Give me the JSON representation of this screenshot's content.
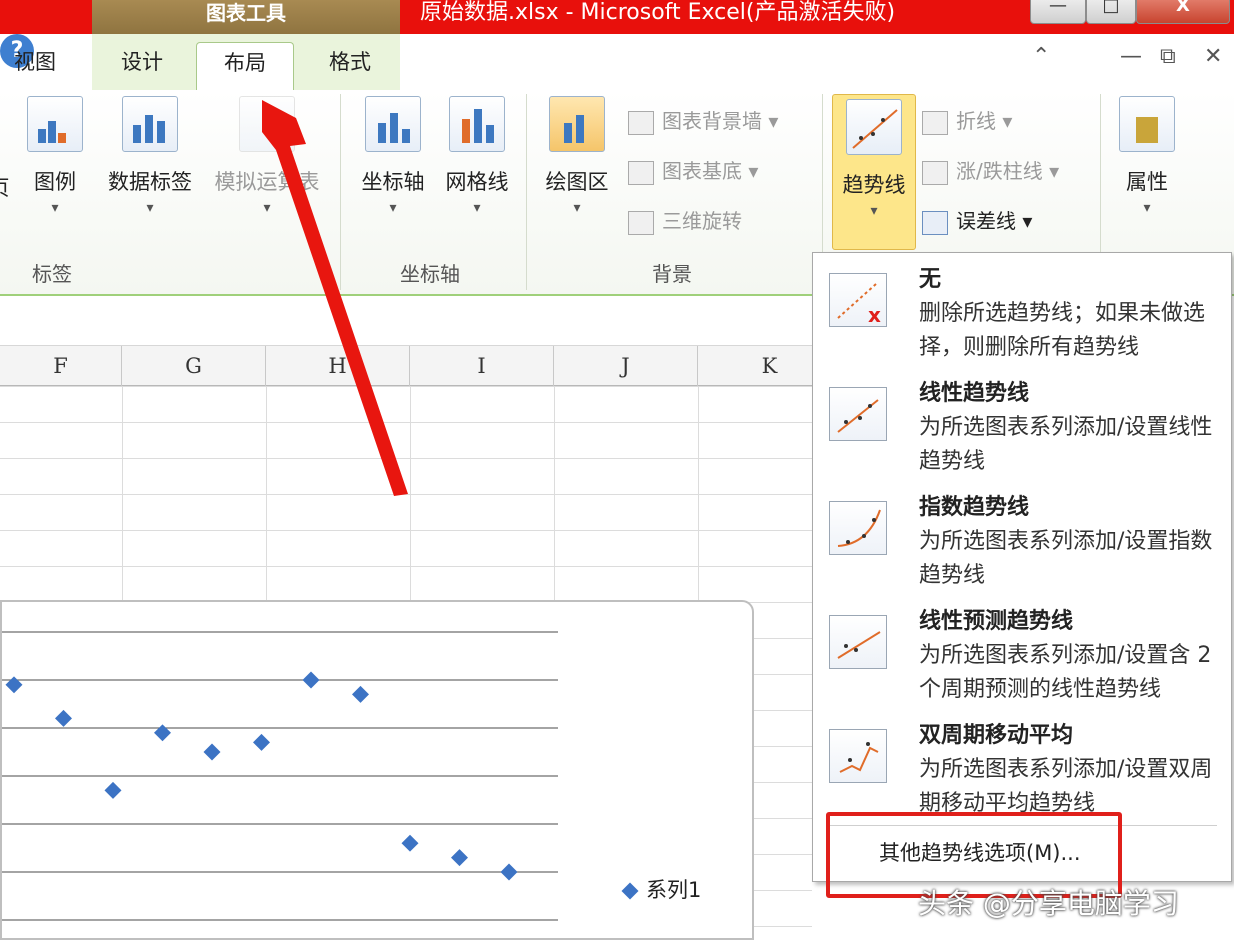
{
  "title_bar": {
    "tools_tab": "图表工具",
    "document_title": "原始数据.xlsx - Microsoft Excel(产品激活失败)",
    "minimize": "—",
    "maximize": "□",
    "close": "X"
  },
  "tabs": {
    "view": "视图",
    "design": "设计",
    "layout": "布局",
    "format": "格式",
    "active": "布局"
  },
  "tabrow_icons": {
    "collapse": "⌃",
    "help": "?",
    "min": "—",
    "restore": "⧉",
    "close": "✕"
  },
  "ribbon": {
    "labels_group": {
      "label": "标签",
      "partial": "页",
      "legend": "图例",
      "data_labels": "数据标签",
      "data_table": "模拟运算表"
    },
    "axes_group": {
      "label": "坐标轴",
      "axes": "坐标轴",
      "gridlines": "网格线"
    },
    "background_group": {
      "label": "背景",
      "plot_area": "绘图区",
      "chart_wall": "图表背景墙",
      "chart_floor": "图表基底",
      "rotation": "三维旋转"
    },
    "analysis_group": {
      "trendline": "趋势线",
      "lines": "折线",
      "updown_bars": "涨/跌柱线",
      "error_bars": "误差线"
    },
    "properties": {
      "label": "属性"
    }
  },
  "columns": [
    "F",
    "G",
    "H",
    "I",
    "J",
    "K"
  ],
  "chart_data": {
    "type": "scatter",
    "series": [
      {
        "name": "系列1",
        "values": [
          4.9,
          4.2,
          2.7,
          3.9,
          3.5,
          3.7,
          5.0,
          4.7,
          1.6,
          1.3,
          1.0
        ]
      }
    ],
    "legend_position": "right",
    "grid": true
  },
  "menu": {
    "items": [
      {
        "title": "无",
        "desc": "删除所选趋势线；如果未做选择，则删除所有趋势线"
      },
      {
        "title": "线性趋势线",
        "desc": "为所选图表系列添加/设置线性趋势线"
      },
      {
        "title": "指数趋势线",
        "desc": "为所选图表系列添加/设置指数趋势线"
      },
      {
        "title": "线性预测趋势线",
        "desc": "为所选图表系列添加/设置含 2 个周期预测的线性趋势线"
      },
      {
        "title": "双周期移动平均",
        "desc": "为所选图表系列添加/设置双周期移动平均趋势线"
      }
    ],
    "more_options": "其他趋势线选项(M)..."
  },
  "watermark": "头条 @分享电脑学习",
  "colors": {
    "accent_red": "#e0201b",
    "marker_blue": "#3c73c4",
    "title_red": "#e8100c"
  }
}
